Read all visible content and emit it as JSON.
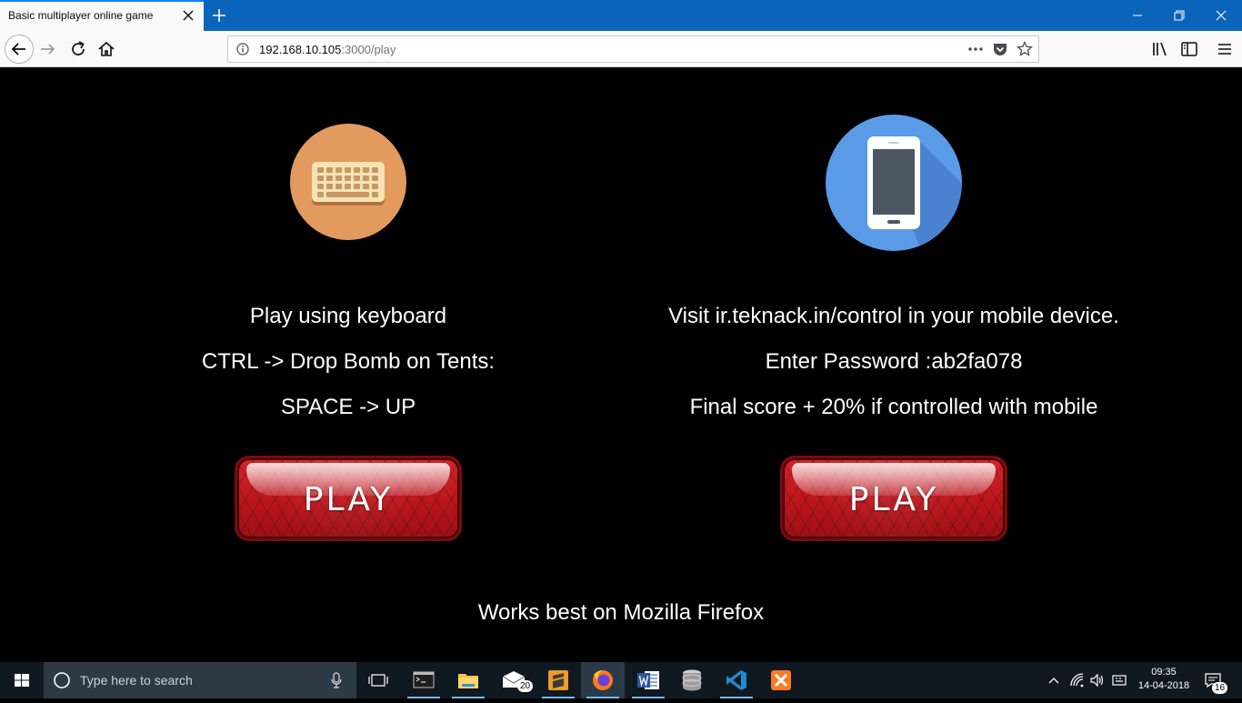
{
  "browser": {
    "tab_title": "Basic multiplayer online game",
    "url_host": "192.168.10.105",
    "url_path": ":3000/play"
  },
  "left_panel": {
    "icon": "keyboard-icon",
    "line1": "Play using keyboard",
    "line2": "CTRL -> Drop Bomb on Tents:",
    "line3": "SPACE -> UP",
    "button": "PLAY"
  },
  "right_panel": {
    "icon": "mobile-phone-icon",
    "line1": "Visit ir.teknack.in/control in your mobile device.",
    "line2": "Enter Password :ab2fa078",
    "line3": "Final score + 20% if controlled with mobile",
    "button": "PLAY"
  },
  "footer_note": "Works best on Mozilla Firefox",
  "taskbar": {
    "search_placeholder": "Type here to search",
    "mail_badge": "20",
    "time": "09:35",
    "date": "14-04-2018",
    "notification_badge": "16"
  },
  "colors": {
    "keyboard_circle": "#e29a5e",
    "phone_circle": "#5a9be8",
    "play_red": "#c4161d",
    "titlebar_blue": "#0a64b9"
  }
}
